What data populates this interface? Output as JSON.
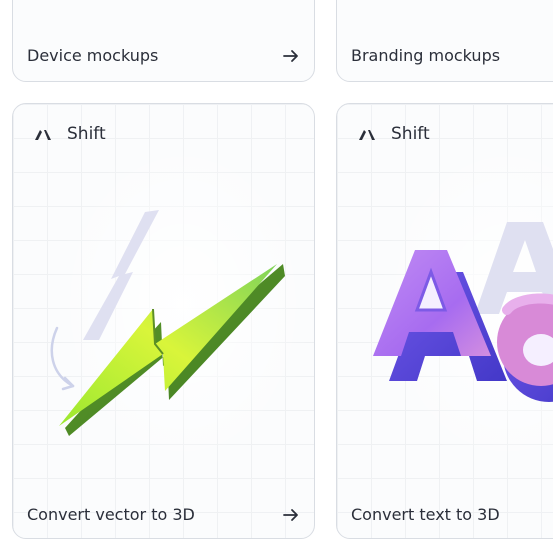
{
  "cards": [
    {
      "title": "Device mockups",
      "arrow_icon": "arrow-right-icon"
    },
    {
      "title": "Branding mockups",
      "arrow_icon": "arrow-right-icon"
    },
    {
      "brand": "Shift",
      "title": "Convert vector to 3D",
      "arrow_icon": "arrow-right-icon",
      "logo_icon": "shift-logo-icon",
      "art_icon": "3d-lightning-bolt-icon"
    },
    {
      "brand": "Shift",
      "title": "Convert text to 3D",
      "arrow_icon": "arrow-right-icon",
      "logo_icon": "shift-logo-icon",
      "art_icon": "3d-text-aa-icon"
    }
  ],
  "colors": {
    "border": "#d9dde3",
    "text": "#2b2f3a",
    "bolt_green": "#b9ec2f",
    "text3d_purple": "#b86cf2"
  }
}
